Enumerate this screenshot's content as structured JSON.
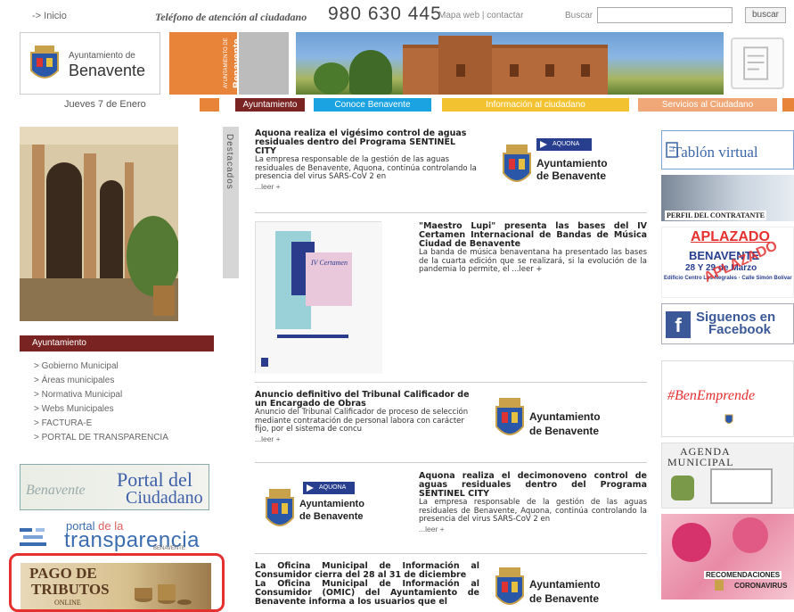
{
  "topbar": {
    "home": "-> Inicio",
    "phone_label": "Teléfono de atención al ciudadano",
    "phone": "980 630 445",
    "links": "Mapa web | contactar",
    "search_label": "Buscar",
    "search_button": "buscar"
  },
  "header": {
    "logo_small": "Ayuntamiento de",
    "logo_city": "Benavente",
    "vertical_small": "AYUNTAMIENTO DE",
    "vertical_big": "Benavente"
  },
  "nav": {
    "date": "Jueves 7 de Enero",
    "items": [
      {
        "label": "Ayuntamiento",
        "color": "#7a2323"
      },
      {
        "label": "Conoce Benavente",
        "color": "#1aa3e0"
      },
      {
        "label": "Información al ciudadano",
        "color": "#f2c230"
      },
      {
        "label": "Servicios al Ciudadano",
        "color": "#f0a878"
      }
    ]
  },
  "left": {
    "section_title": "Ayuntamiento",
    "menu": [
      "> Gobierno Municipal",
      "> Áreas municipales",
      "> Normativa Municipal",
      "> Webs Municipales",
      "> FACTURA-E",
      "> PORTAL DE TRANSPARENCIA"
    ],
    "portal_ciudadano": {
      "cursive": "Benavente",
      "line1": "Portal del",
      "line2": "Ciudadano"
    },
    "portal_transparencia": {
      "line1a": "portal",
      "line1b": "de la",
      "line2": "transparencia",
      "line3": "BENAVENTE"
    },
    "pago": {
      "line1": "PAGO DE",
      "line2": "TRIBUTOS",
      "line3": "ONLINE"
    }
  },
  "destacados": "Destacados",
  "news": [
    {
      "title": "Aquona realiza el vigésimo control de aguas residuales dentro del Programa SENTINEL CITY",
      "body": "La empresa responsable de la gestión de las aguas residuales de Benavente, Aquona, continúa controlando la presencia del virus SARS-CoV 2 en",
      "more": "...leer +"
    },
    {
      "title": "\"Maestro Lupi\" presenta las bases del IV Certamen Internacional de Bandas de Música Ciudad de Benavente",
      "body": "La banda de música benaventana ha presentado las bases de la cuarta edición que se realizará, si la evolución de la pandemia lo permite, el ...leer +",
      "more": ""
    },
    {
      "title": "Anuncio definitivo del Tribunal Calificador de un Encargado de Obras",
      "body": "Anuncio del Tribunal Calificador de proceso de selección mediante contratación de personal labora con carácter fijo, por el sistema de concu",
      "more": "...leer +"
    },
    {
      "title": "Aquona realiza el decimonoveno control de aguas residuales dentro del Programa SENTINEL CITY",
      "body": "La empresa responsable de la gestión de las aguas residuales de Benavente, Aquona, continúa controlando la presencia del virus SARS-CoV 2 en",
      "more": "...leer +"
    },
    {
      "title": "La Oficina Municipal de Información al Consumidor cierra del 28 al 31 de diciembre",
      "body_bold": "La Oficina Municipal de Información al Consumidor (OMIC) del Ayuntamiento de Benavente informa a los usuarios que el",
      "more": ""
    }
  ],
  "ayto_logo": {
    "line1": "Ayuntamiento",
    "line2": "de Benavente"
  },
  "aquona": "AQUONA",
  "poster": {
    "title": "Certamen Ciudad de Benavente"
  },
  "right": {
    "tablon": "Tablón virtual",
    "perfil": "PERFIL DEL CONTRATANTE",
    "aplazado": "APLAZADO",
    "benavente": "BENAVENTE",
    "fecha": "28 Y 29 de Marzo",
    "lugar": "Edificio Centro Los Negrales · Calle Simón Bolívar",
    "aplazado_stamp": "APLAZADO",
    "facebook_line1": "Siguenos en",
    "facebook_line2": "Facebook",
    "benemprende": "#BenEmprende",
    "agenda1": "AGENDA",
    "agenda2": "MUNICIPAL",
    "corona1": "RECOMENDACIONES",
    "corona2": "CORONAVIRUS"
  }
}
